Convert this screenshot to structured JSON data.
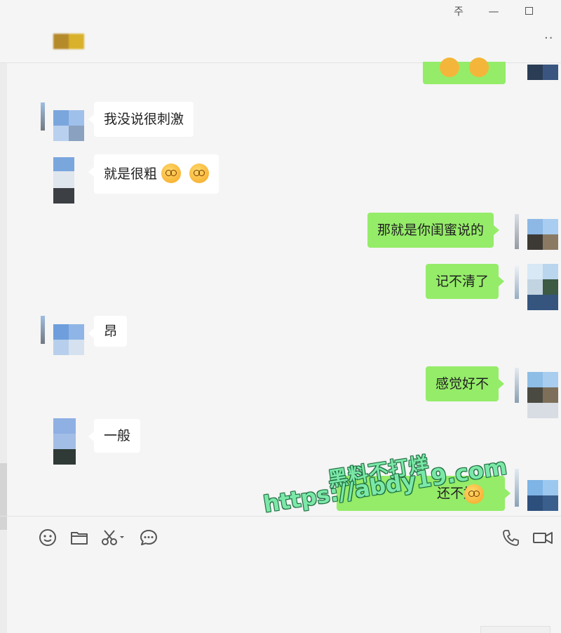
{
  "window": {
    "controls": [
      {
        "name": "pin",
        "glyph": "주"
      },
      {
        "name": "minimize",
        "glyph": "—"
      },
      {
        "name": "maximize",
        "glyph": ""
      }
    ],
    "more_glyph": "··"
  },
  "messages": [
    {
      "side": "in",
      "text": "我没说很刺激"
    },
    {
      "side": "in",
      "text": "就是很粗"
    },
    {
      "side": "out",
      "text": "那就是你闺蜜说的"
    },
    {
      "side": "out",
      "text": "记不清了"
    },
    {
      "side": "in",
      "text": "昂"
    },
    {
      "side": "out",
      "text": "感觉好不"
    },
    {
      "side": "in",
      "text": "一般"
    },
    {
      "side": "out",
      "text": "还不好"
    }
  ],
  "watermark": {
    "line1": "黑料不打烊",
    "line2": "https://abdy19.com"
  },
  "toolbar": {
    "icons": [
      "emoji-icon",
      "folder-icon",
      "scissors-icon",
      "chat-history-icon",
      "phone-icon",
      "video-icon"
    ]
  },
  "colors": {
    "outgoing_bubble": "#95ec69",
    "incoming_bubble": "#ffffff",
    "background": "#f5f5f5"
  }
}
